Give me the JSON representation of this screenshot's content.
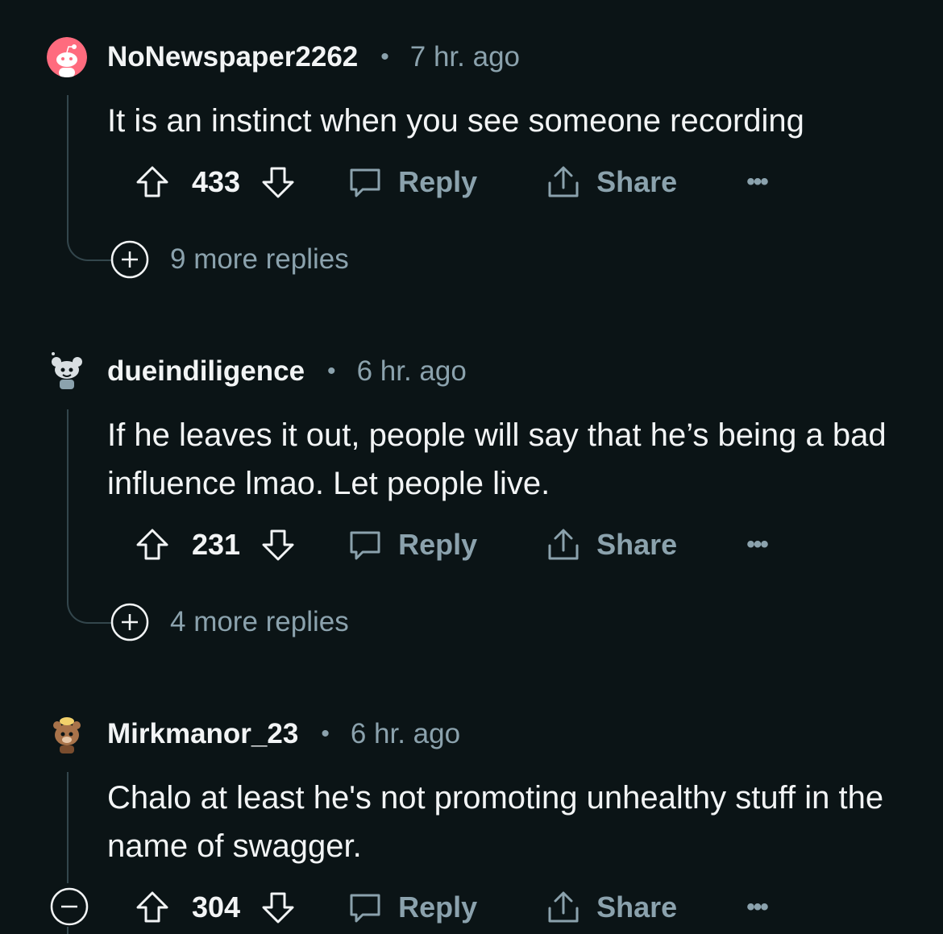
{
  "comments": [
    {
      "username": "NoNewspaper2262",
      "separator": "•",
      "time": "7 hr. ago",
      "body": "It is an instinct when you see someone recording",
      "score": "433",
      "reply_label": "Reply",
      "share_label": "Share",
      "more_label": "•••",
      "more_replies": "9 more replies",
      "avatar_color": "#ff6b7e"
    },
    {
      "username": "dueindiligence",
      "separator": "•",
      "time": "6 hr. ago",
      "body": "If he leaves it out, people will say that he’s being a bad influence lmao. Let people live.",
      "score": "231",
      "reply_label": "Reply",
      "share_label": "Share",
      "more_label": "•••",
      "more_replies": "4 more replies",
      "avatar_color": "#d9dfe2"
    },
    {
      "username": "Mirkmanor_23",
      "separator": "•",
      "time": "6 hr. ago",
      "body": "Chalo at least he's not promoting unhealthy stuff in the name of swagger.",
      "score": "304",
      "reply_label": "Reply",
      "share_label": "Share",
      "more_label": "•••",
      "avatar_color": "#a8734a"
    }
  ],
  "colors": {
    "background": "#0b1416",
    "text": "#f2f4f5",
    "muted": "#8ba2ad",
    "thread_line": "#33464c"
  }
}
